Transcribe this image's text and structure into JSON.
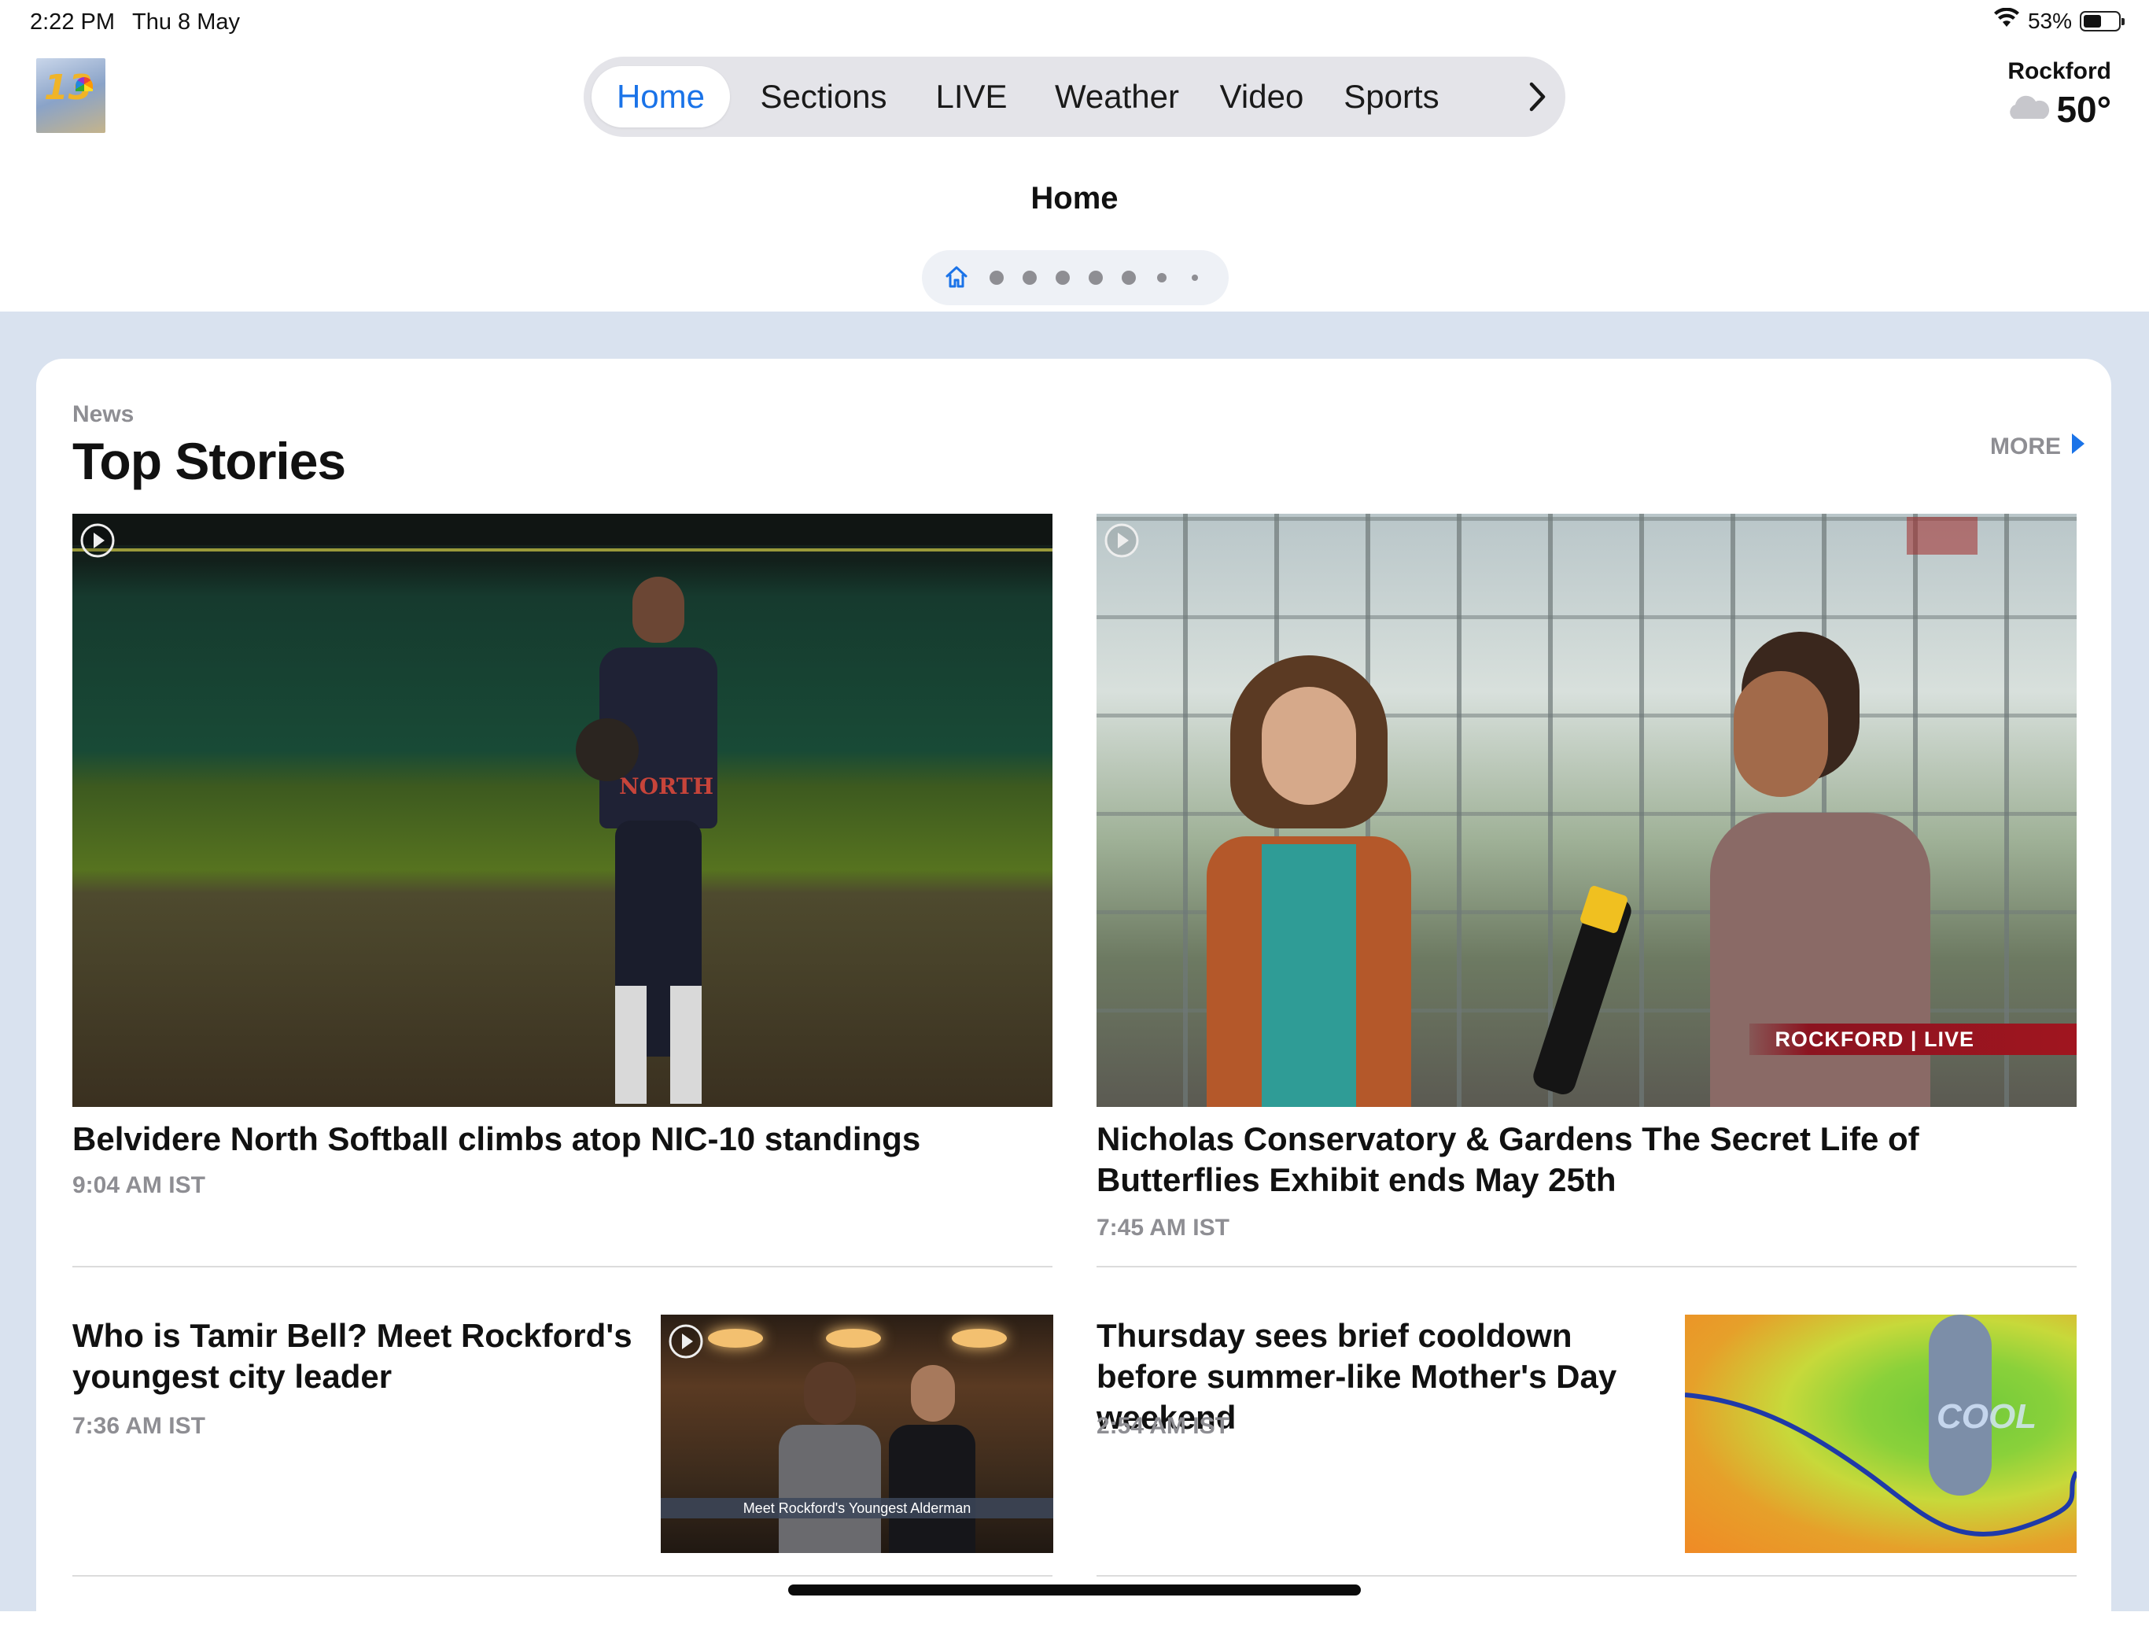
{
  "status_bar": {
    "time": "2:22 PM",
    "date": "Thu 8 May",
    "battery": "53%",
    "battery_level": 0.53
  },
  "header": {
    "logo_text": "13",
    "tabs": [
      {
        "label": "Home",
        "active": true
      },
      {
        "label": "Sections",
        "active": false
      },
      {
        "label": "LIVE",
        "active": false
      },
      {
        "label": "Weather",
        "active": false
      },
      {
        "label": "Video",
        "active": false
      },
      {
        "label": "Sports",
        "active": false
      }
    ],
    "more_tabs_icon": "chevron-right-icon",
    "weather": {
      "city": "Rockford",
      "temp": "50°",
      "icon": "cloud-icon"
    }
  },
  "page": {
    "title": "Home",
    "pager": {
      "current_icon": "home-icon",
      "dots": 7
    }
  },
  "section": {
    "kicker": "News",
    "title": "Top Stories",
    "more_label": "MORE"
  },
  "stories": [
    {
      "title": "Belvidere North Softball climbs atop NIC-10 standings",
      "time": "9:04 AM IST",
      "has_video": true,
      "jersey_text": "NORTH"
    },
    {
      "title": "Nicholas Conservatory & Gardens The Secret Life of Butterflies Exhibit ends May 25th",
      "time": "7:45 AM IST",
      "has_video": true,
      "overlay_text": "ROCKFORD | LIVE"
    },
    {
      "title": "Who is Tamir Bell? Meet Rockford's youngest city leader",
      "time": "7:36 AM IST",
      "has_video": true,
      "overlay_text": "Meet Rockford's Youngest Alderman"
    },
    {
      "title": "Thursday sees brief cooldown before summer-like Mother's Day weekend",
      "time": "2:54 AM IST",
      "has_video": false,
      "overlay_text": "COOL"
    }
  ],
  "colors": {
    "accent": "#1a73e8",
    "background_band": "#d9e2ef",
    "muted_text": "#8e8e93"
  }
}
